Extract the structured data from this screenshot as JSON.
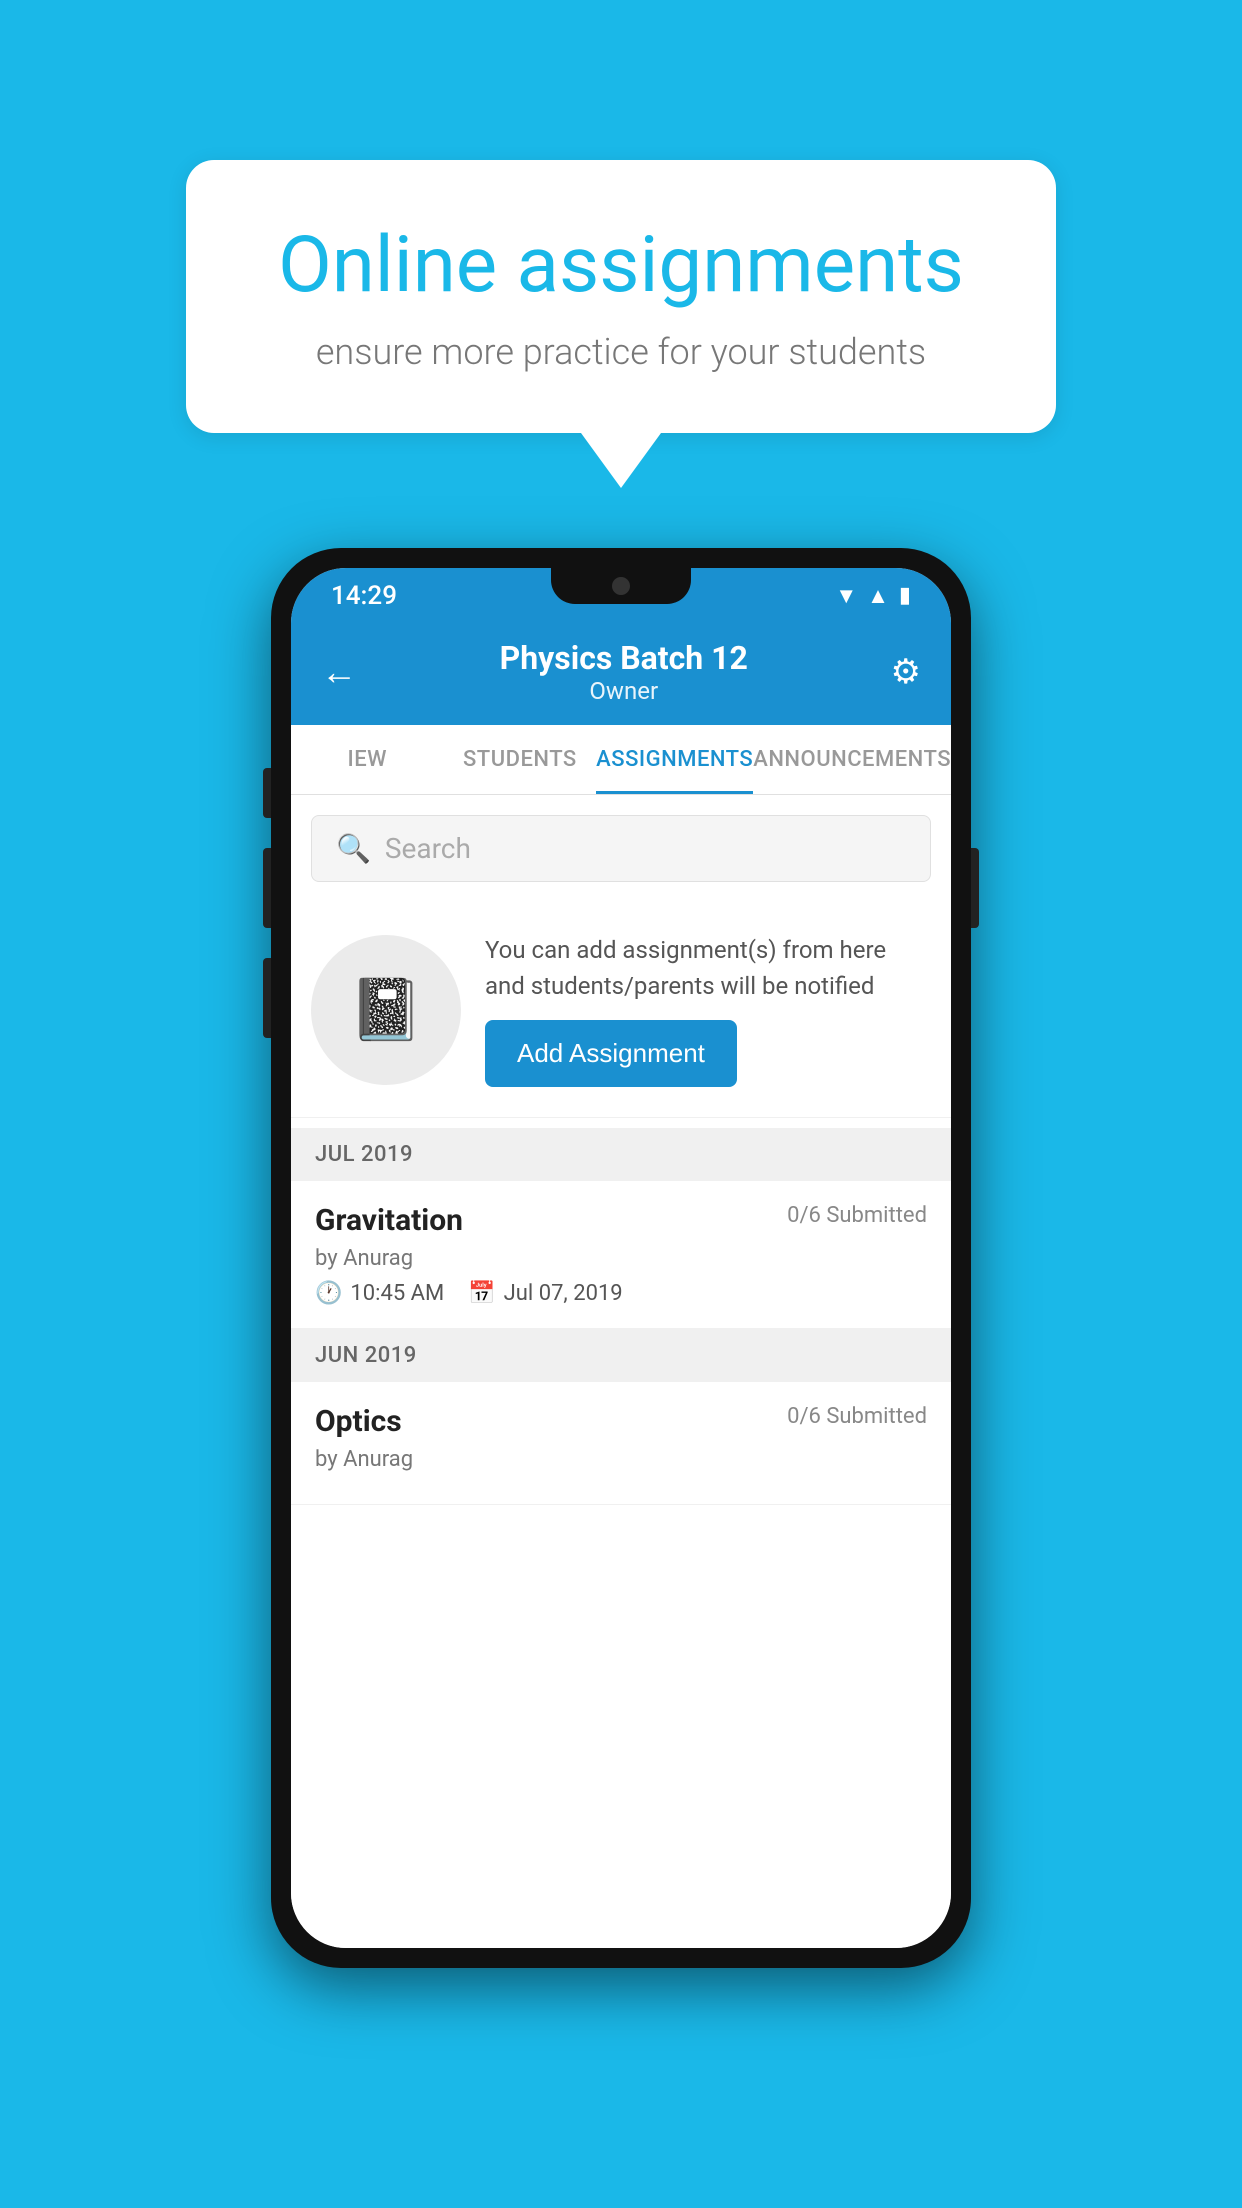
{
  "background_color": "#1ab8e8",
  "speech_bubble": {
    "title": "Online assignments",
    "subtitle": "ensure more practice for your students"
  },
  "phone": {
    "status_bar": {
      "time": "14:29",
      "icons": [
        "wifi",
        "signal",
        "battery"
      ]
    },
    "header": {
      "title": "Physics Batch 12",
      "subtitle": "Owner",
      "back_label": "←",
      "settings_label": "⚙"
    },
    "tabs": [
      {
        "label": "IEW",
        "active": false
      },
      {
        "label": "STUDENTS",
        "active": false
      },
      {
        "label": "ASSIGNMENTS",
        "active": true
      },
      {
        "label": "ANNOUNCEMENTS",
        "active": false
      }
    ],
    "search": {
      "placeholder": "Search"
    },
    "empty_state": {
      "description": "You can add assignment(s) from here and students/parents will be notified",
      "button_label": "Add Assignment"
    },
    "sections": [
      {
        "header": "JUL 2019",
        "items": [
          {
            "name": "Gravitation",
            "submitted": "0/6 Submitted",
            "author": "by Anurag",
            "time": "10:45 AM",
            "date": "Jul 07, 2019"
          }
        ]
      },
      {
        "header": "JUN 2019",
        "items": [
          {
            "name": "Optics",
            "submitted": "0/6 Submitted",
            "author": "by Anurag",
            "time": "",
            "date": ""
          }
        ]
      }
    ]
  }
}
